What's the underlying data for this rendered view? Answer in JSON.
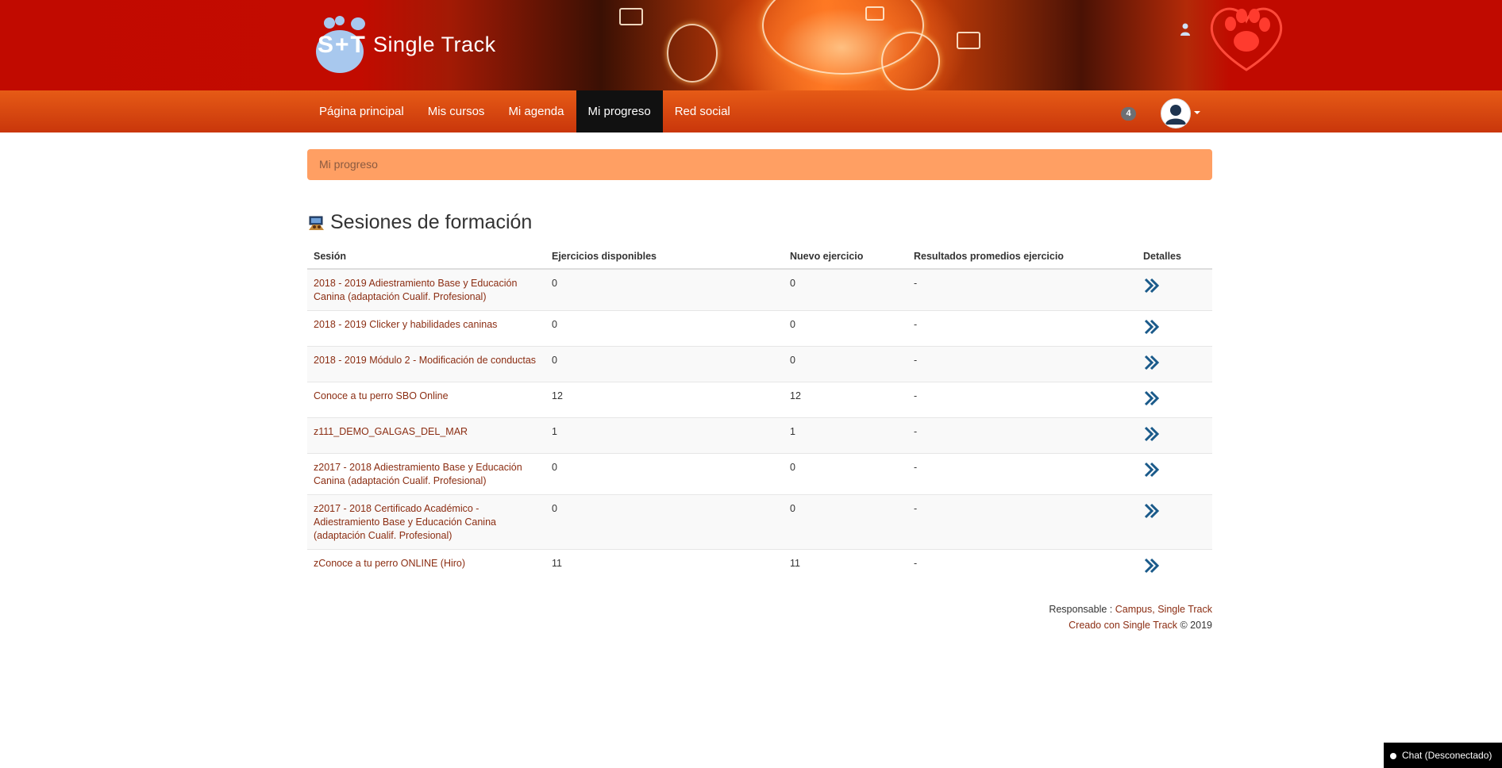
{
  "brand": {
    "name": "Single Track",
    "mark": "S+T"
  },
  "nav": {
    "items": [
      {
        "label": "Página principal",
        "active": false
      },
      {
        "label": "Mis cursos",
        "active": false
      },
      {
        "label": "Mi agenda",
        "active": false
      },
      {
        "label": "Mi progreso",
        "active": true
      },
      {
        "label": "Red social",
        "active": false
      }
    ],
    "notification_count": "4"
  },
  "breadcrumb": "Mi progreso",
  "section": {
    "title": "Sesiones de formación"
  },
  "table": {
    "headers": [
      "Sesión",
      "Ejercicios disponibles",
      "Nuevo ejercicio",
      "Resultados promedios ejercicio",
      "Detalles"
    ],
    "rows": [
      {
        "session": "2018 - 2019 Adiestramiento Base y Educación Canina (adaptación Cualif. Profesional)",
        "available": "0",
        "new": "0",
        "avg": "-"
      },
      {
        "session": "2018 - 2019 Clicker y habilidades caninas",
        "available": "0",
        "new": "0",
        "avg": "-"
      },
      {
        "session": "2018 - 2019 Módulo 2 - Modificación de conductas",
        "available": "0",
        "new": "0",
        "avg": "-"
      },
      {
        "session": "Conoce a tu perro SBO Online",
        "available": "12",
        "new": "12",
        "avg": "-"
      },
      {
        "session": "z111_DEMO_GALGAS_DEL_MAR",
        "available": "1",
        "new": "1",
        "avg": "-"
      },
      {
        "session": "z2017 - 2018 Adiestramiento Base y Educación Canina (adaptación Cualif. Profesional)",
        "available": "0",
        "new": "0",
        "avg": "-"
      },
      {
        "session": "z2017 - 2018 Certificado Académico - Adiestramiento Base y Educación Canina (adaptación Cualif. Profesional)",
        "available": "0",
        "new": "0",
        "avg": "-"
      },
      {
        "session": "zConoce a tu perro ONLINE (Hiro)",
        "available": "11",
        "new": "11",
        "avg": "-"
      }
    ]
  },
  "footer": {
    "responsible_prefix": "Responsable : ",
    "responsible_link": "Campus, Single Track",
    "created_link": "Creado con Single Track",
    "copyright": " © 2019"
  },
  "chat": {
    "label": "Chat (Desconectado)"
  },
  "icons": {
    "details": "double-chevron-right-icon",
    "section": "training-sessions-icon",
    "avatar": "user-avatar-icon"
  },
  "colors": {
    "banner_red": "#c10a00",
    "nav_orange": "#e65b16",
    "breadcrumb_bg": "#ff9f63",
    "link": "#8b2d12",
    "chevron": "#1a5a8a"
  }
}
